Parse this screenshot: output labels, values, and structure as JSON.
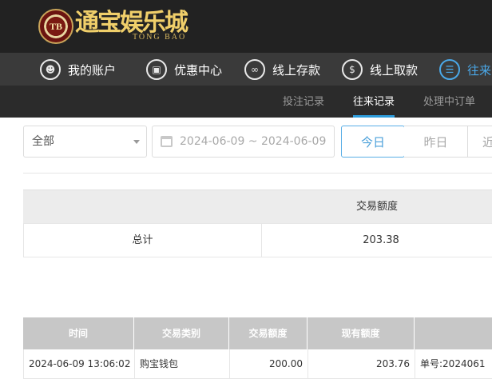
{
  "logo": {
    "chip_text": "TB",
    "title_cn": "通宝娱乐城",
    "title_en": "TONG BAO"
  },
  "nav": {
    "items": [
      {
        "label": "我的账户",
        "icon": "user-icon"
      },
      {
        "label": "优惠中心",
        "icon": "gift-icon"
      },
      {
        "label": "线上存款",
        "icon": "deposit-icon"
      },
      {
        "label": "线上取款",
        "icon": "withdraw-icon"
      },
      {
        "label": "往来",
        "icon": "records-icon"
      }
    ]
  },
  "subnav": {
    "items": [
      "投注记录",
      "往来记录",
      "处理中订单"
    ],
    "active": "往来记录"
  },
  "filter": {
    "type_select": "全部",
    "date_range": "2024-06-09 ~ 2024-06-09",
    "quick_buttons": [
      "今日",
      "昨日",
      "近"
    ],
    "active_button": "今日"
  },
  "summary": {
    "header": "交易额度",
    "row_label": "总计",
    "row_value": "203.38"
  },
  "records": {
    "columns": [
      "时间",
      "交易类别",
      "交易额度",
      "现有额度",
      ""
    ],
    "rows": [
      {
        "time": "2024-06-09 13:06:02",
        "category": "购宝钱包",
        "amount": "200.00",
        "balance": "203.76",
        "note": "单号:2024061"
      }
    ]
  },
  "colors": {
    "header_bg": "#222222",
    "nav_bg": "#3a3a3a",
    "subnav_bg": "#2b2b2b",
    "accent": "#2d9cdb",
    "logo_gold": "#f0cf6a"
  }
}
